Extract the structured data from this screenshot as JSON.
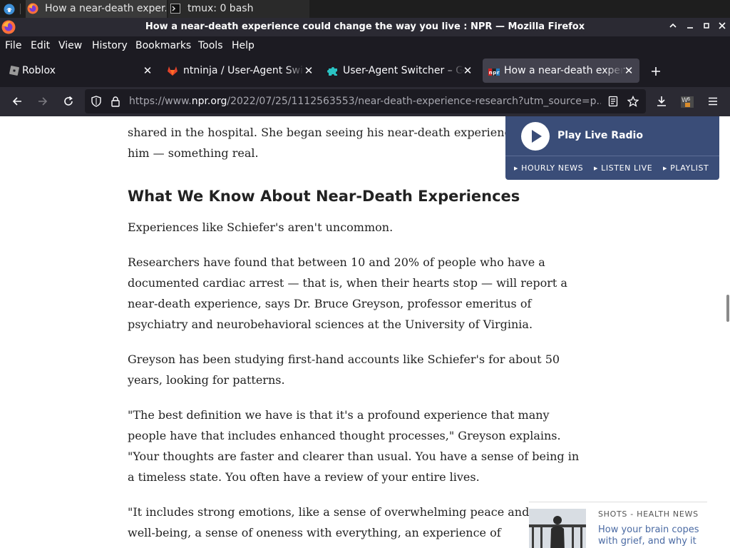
{
  "taskbar": {
    "items": [
      {
        "label": "How a near-death exper...",
        "active": true
      },
      {
        "label": "tmux: 0 bash",
        "active": false
      }
    ]
  },
  "window": {
    "title": "How a near-death experience could change the way you live : NPR — Mozilla Firefox"
  },
  "menubar": {
    "items": [
      "File",
      "Edit",
      "View",
      "History",
      "Bookmarks",
      "Tools",
      "Help"
    ]
  },
  "tabs": [
    {
      "label": "Roblox",
      "favicon": "roblox-icon",
      "active": false
    },
    {
      "label": "ntninja / User-Agent Switcher",
      "favicon": "gitlab-fox-icon",
      "active": false
    },
    {
      "label": "User-Agent Switcher – Get",
      "favicon": "addon-puzzle-icon",
      "active": false
    },
    {
      "label": "How a near-death experience",
      "favicon": "npr-icon",
      "active": true
    }
  ],
  "toolbar": {
    "url_prefix": "https://www.",
    "url_domain": "npr.org",
    "url_rest": "/2022/07/25/1112563553/near-death-experience-research?utm_source=p..."
  },
  "radio": {
    "label": "Play Live Radio",
    "links": [
      "HOURLY NEWS",
      "LISTEN LIVE",
      "PLAYLIST"
    ]
  },
  "article": {
    "p0": "shared in the hospital. She began seeing his near-death experience as w",
    "p0b": "him — something real.",
    "heading": "What We Know About Near-Death Experiences",
    "p1": "Experiences like Schiefer's aren't uncommon.",
    "p2": "Researchers have found that between 10 and 20% of people who have a documented cardiac arrest — that is, when their hearts stop — will report a near-death experience, says Dr. Bruce Greyson, professor emeritus of psychiatry and neurobehavioral sciences at the University of Virginia.",
    "p3": "Greyson has been studying first-hand accounts like Schiefer's for about 50 years, looking for patterns.",
    "p4": "\"The best definition we have is that it's a profound experience that many people have that includes enhanced thought processes,\" Greyson explains. \"Your thoughts are faster and clearer than usual. You have a sense of being in a timeless state. You often have a review of your entire lives.",
    "p5a": "\"It includes strong emotions, like a sense of overwhelming peace and",
    "p5b": "well-being, a sense of oneness with everything, an experience of"
  },
  "related": {
    "kicker": "SHOTS - HEALTH NEWS",
    "title": "How your brain copes with grief, and why it"
  },
  "colors": {
    "radio_bg": "#3a4d78",
    "link": "#4a6aa3",
    "active_tab": "#42414d",
    "menubar": "#1c1b22"
  }
}
